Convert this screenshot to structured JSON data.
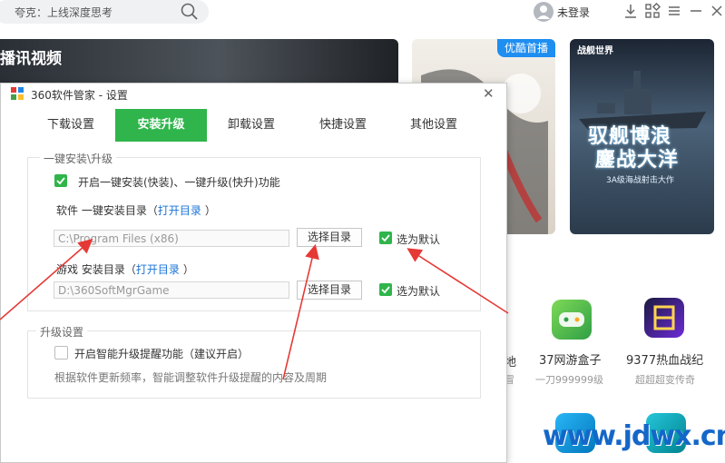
{
  "topbar": {
    "search_placeholder": "夸克：上线深度思考",
    "login": "未登录"
  },
  "banners": {
    "main_text": "播讯视频",
    "youku_badge": "优酷首播",
    "game_logo": "战舰世界",
    "game_title_line1": "驭舰博浪",
    "game_title_line2": "鏖战大洋",
    "game_sub": "3A级海战射击大作"
  },
  "apps": {
    "fragment_name": "地",
    "fragment_sub": "冒",
    "app1_name": "37网游盒子",
    "app1_sub": "一刀999999级",
    "app2_name": "9377热血战纪",
    "app2_sub": "超超超变传奇"
  },
  "watermark": "www.jdwx.cn",
  "dialog": {
    "title": "360软件管家 - 设置",
    "tabs": [
      "下载设置",
      "安装升级",
      "卸载设置",
      "快捷设置",
      "其他设置"
    ],
    "group1": {
      "label": "一键安装\\升级",
      "enable_label": "开启一键安装(快装)、一键升级(快升)功能",
      "software_dir_label": "软件 一键安装目录（",
      "software_dir_link": "打开目录",
      "software_dir_close": "）",
      "software_dir_value": "C:\\Program Files (x86)",
      "choose_dir_1": "选择目录",
      "default_1": "选为默认",
      "game_dir_label": "游戏 安装目录（",
      "game_dir_link": "打开目录",
      "game_dir_close": "）",
      "game_dir_value": "D:\\360SoftMgrGame",
      "choose_dir_2": "选择目录",
      "default_2": "选为默认"
    },
    "group2": {
      "label": "升级设置",
      "smart_upgrade_label": "开启智能升级提醒功能（建议开启）",
      "smart_upgrade_desc": "根据软件更新频率，智能调整软件升级提醒的内容及周期"
    }
  },
  "colors": {
    "accent_green": "#2fb54b",
    "link_blue": "#1a73d8",
    "annotation_red": "#e53935",
    "watermark_blue": "#1467c9"
  }
}
